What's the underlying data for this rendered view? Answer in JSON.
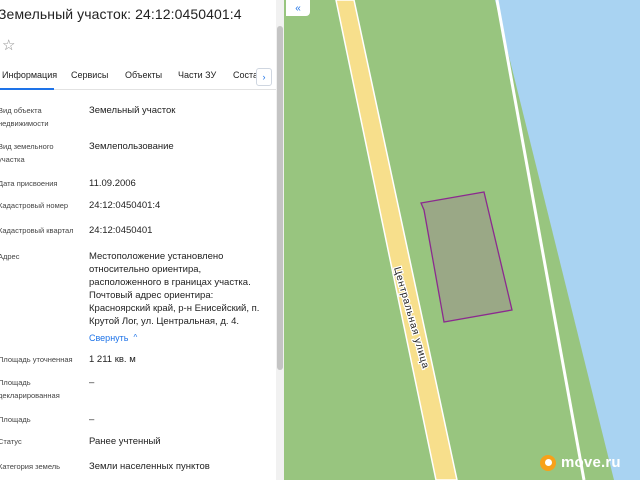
{
  "panel": {
    "title": "Земельный участок: 24:12:0450401:4",
    "star_icon": "☆"
  },
  "tabs": [
    {
      "label": "Информация",
      "active": true
    },
    {
      "label": "Сервисы",
      "active": false
    },
    {
      "label": "Объекты",
      "active": false
    },
    {
      "label": "Части ЗУ",
      "active": false
    },
    {
      "label": "Соста",
      "active": false
    }
  ],
  "tabs_next_icon": "›",
  "rows": [
    {
      "label": "Вид объекта недвижимости",
      "value": "Земельный участок"
    },
    {
      "label": "Вид земельного участка",
      "value": "Землепользование"
    },
    {
      "label": "Дата присвоения",
      "value": "11.09.2006"
    },
    {
      "label": "Кадастровый номер",
      "value": "24:12:0450401:4"
    },
    {
      "label": "Кадастровый квартал",
      "value": "24:12:0450401"
    },
    {
      "label": "Адрес",
      "value": "Местоположение установлено относительно ориентира, расположенного в границах участка. Почтовый адрес ориентира: Красноярский край, р-н Енисейский, п. Крутой Лог, ул. Центральная, д. 4."
    },
    {
      "label": "Площадь уточненная",
      "value": "1 211 кв. м"
    },
    {
      "label": "Площадь декларированная",
      "value": "–"
    },
    {
      "label": "Площадь",
      "value": "–"
    },
    {
      "label": "Статус",
      "value": "Ранее учтенный"
    },
    {
      "label": "Категория земель",
      "value": "Земли населенных пунктов"
    }
  ],
  "collapse": {
    "label": "Свернуть",
    "icon": "^"
  },
  "map": {
    "collapse_button": "«",
    "street_label": "Центральная улица",
    "logo_text": "move.ru",
    "colors": {
      "land": "#98c57f",
      "water": "#a9d3f2",
      "road": "#f7df8c",
      "parcel_fill": "#9aa487",
      "parcel_border": "#8b2a8f",
      "accent": "#1e73e8",
      "logo": "#f7a11a"
    }
  }
}
